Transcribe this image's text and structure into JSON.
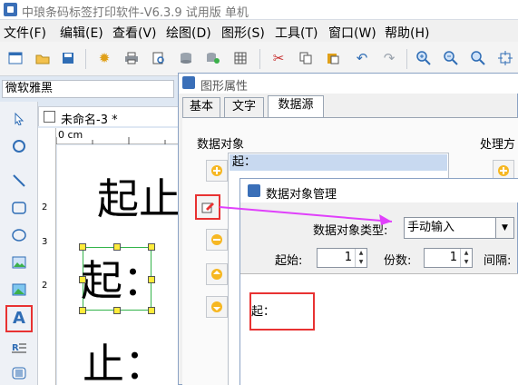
{
  "app": {
    "title": "中琅条码标签打印软件-V6.3.9 试用版 单机"
  },
  "menu": [
    "文件(F)",
    "编辑(E)",
    "查看(V)",
    "绘图(D)",
    "图形(S)",
    "工具(T)",
    "窗口(W)",
    "帮助(H)"
  ],
  "toolbar": {
    "icons": [
      "new-icon",
      "open-icon",
      "save-icon",
      "settings-icon",
      "print-icon",
      "print-preview-icon",
      "database-icon",
      "database-settings-icon",
      "grid-icon",
      "cut-icon",
      "copy-icon",
      "paste-icon",
      "undo-icon",
      "redo-icon",
      "zoom-in-icon",
      "zoom-out-icon",
      "zoom-fit-icon",
      "fit-page-icon"
    ]
  },
  "font_selector": {
    "value": "微软雅黑"
  },
  "document": {
    "tab_label": "未命名-3 *",
    "ruler_unit": "0 cm",
    "ruler_marks": [
      "2",
      "3",
      "2"
    ],
    "canvas_texts": [
      "起止",
      "起：",
      "止："
    ]
  },
  "properties": {
    "title": "图形属性",
    "tabs": [
      "基本",
      "文字",
      "数据源"
    ],
    "active_tab": "数据源",
    "data_object_label": "数据对象",
    "processing_label": "处理方",
    "data_object_items": [
      "起："
    ]
  },
  "dialog": {
    "title": "数据对象管理",
    "type_label": "数据对象类型:",
    "type_value": "手动输入",
    "start_label": "起始:",
    "start_value": "1",
    "count_label": "份数:",
    "count_value": "1",
    "interval_label": "间隔:",
    "content": "起："
  },
  "colors": {
    "accent": "#3a6fb8",
    "highlight": "#e83232",
    "arrow": "#e040fb",
    "selection": "#c8d9f0"
  }
}
